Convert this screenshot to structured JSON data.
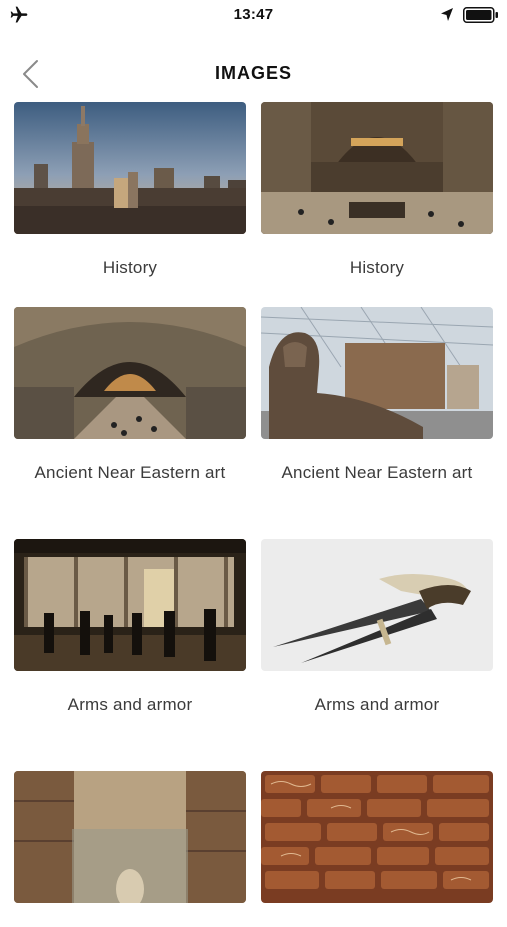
{
  "status_bar": {
    "time": "13:47",
    "left_icon": "airplane-icon",
    "right_icons": [
      "location-arrow-icon",
      "battery-icon"
    ]
  },
  "nav": {
    "title": "IMAGES",
    "back_icon": "chevron-left-icon"
  },
  "images": [
    {
      "caption": "History",
      "thumbnail": "manhattan-skyline-photo"
    },
    {
      "caption": "History",
      "thumbnail": "museum-great-hall-photo"
    },
    {
      "caption": "Ancient Near Eastern art",
      "thumbnail": "vaulted-gallery-photo"
    },
    {
      "caption": "Ancient Near Eastern art",
      "thumbnail": "sphinx-temple-photo"
    },
    {
      "caption": "Arms and armor",
      "thumbnail": "gallery-window-silhouettes-photo"
    },
    {
      "caption": "Arms and armor",
      "thumbnail": "dagger-photo"
    },
    {
      "caption": "",
      "thumbnail": "glass-case-relief-photo"
    },
    {
      "caption": "",
      "thumbnail": "brick-pattern-photo"
    }
  ]
}
